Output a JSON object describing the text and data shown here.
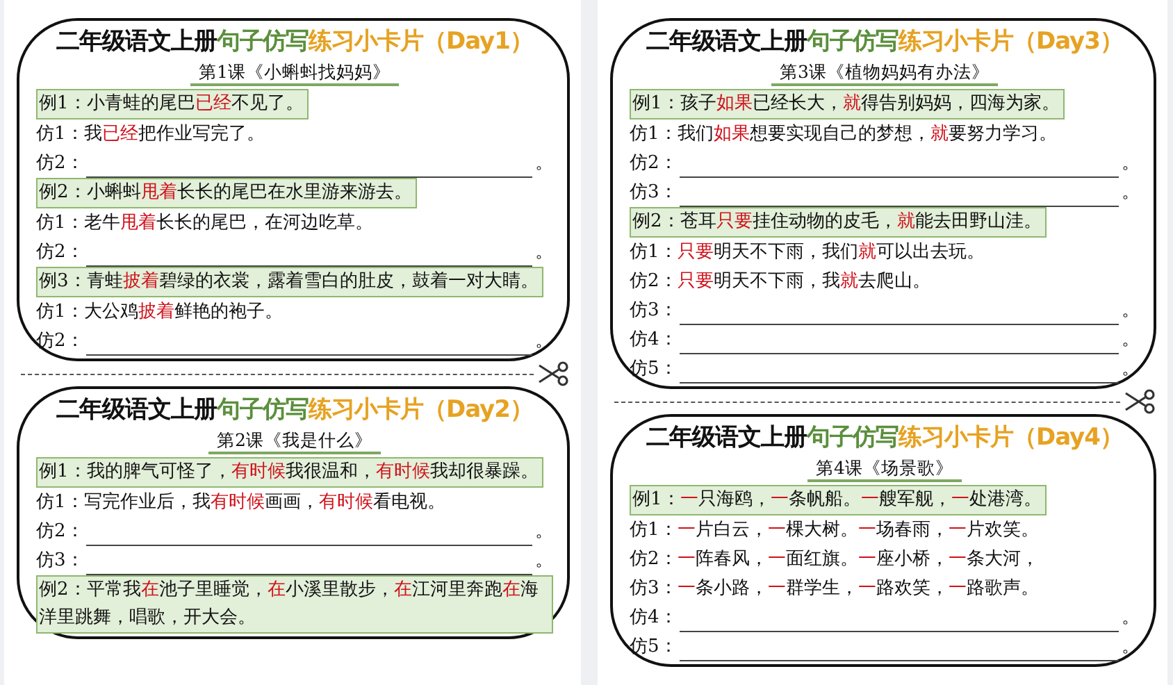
{
  "columns": [
    {
      "cards": [
        {
          "title_parts": [
            {
              "text": "二年级语文上册",
              "color": "#111111"
            },
            {
              "text": "句子仿写",
              "color": "#5b8f3c"
            },
            {
              "text": "练习小卡片（Day1）",
              "color": "#e6a222"
            }
          ],
          "lesson": "第1课《小蝌蚪找妈妈》",
          "rows": [
            {
              "kind": "example",
              "label": "例1：",
              "segments": [
                {
                  "text": "小青蛙的尾巴",
                  "highlight": false
                },
                {
                  "text": "已经",
                  "highlight": true
                },
                {
                  "text": "不见了。",
                  "highlight": false
                }
              ]
            },
            {
              "kind": "imitation",
              "label": "仿1：",
              "segments": [
                {
                  "text": "我",
                  "highlight": false
                },
                {
                  "text": "已经",
                  "highlight": true
                },
                {
                  "text": "把作业写完了。",
                  "highlight": false
                }
              ]
            },
            {
              "kind": "blank",
              "label": "仿2：",
              "end": "。"
            },
            {
              "kind": "example",
              "label": "例2：",
              "segments": [
                {
                  "text": "小蝌蚪",
                  "highlight": false
                },
                {
                  "text": "甩着",
                  "highlight": true
                },
                {
                  "text": "长长的尾巴在水里游来游去。",
                  "highlight": false
                }
              ]
            },
            {
              "kind": "imitation",
              "label": "仿1：",
              "segments": [
                {
                  "text": "老牛",
                  "highlight": false
                },
                {
                  "text": "甩着",
                  "highlight": true
                },
                {
                  "text": "长长的尾巴，在河边吃草。",
                  "highlight": false
                }
              ]
            },
            {
              "kind": "blank",
              "label": "仿2：",
              "end": "。"
            },
            {
              "kind": "example",
              "label": "例3：",
              "segments": [
                {
                  "text": "青蛙",
                  "highlight": false
                },
                {
                  "text": "披着",
                  "highlight": true
                },
                {
                  "text": "碧绿的衣裳，露着雪白的肚皮，鼓着一对大睛。",
                  "highlight": false
                }
              ]
            },
            {
              "kind": "imitation",
              "label": "仿1：",
              "segments": [
                {
                  "text": "大公鸡",
                  "highlight": false
                },
                {
                  "text": "披着",
                  "highlight": true
                },
                {
                  "text": "鲜艳的袍子。",
                  "highlight": false
                }
              ]
            },
            {
              "kind": "blank",
              "label": "仿2：",
              "end": "。"
            }
          ]
        },
        {
          "title_parts": [
            {
              "text": "二年级语文上册",
              "color": "#111111"
            },
            {
              "text": "句子仿写",
              "color": "#5b8f3c"
            },
            {
              "text": "练习小卡片（Day2）",
              "color": "#e6a222"
            }
          ],
          "lesson": "第2课《我是什么》",
          "rows": [
            {
              "kind": "example",
              "label": "例1：",
              "segments": [
                {
                  "text": "我的脾气可怪了，",
                  "highlight": false
                },
                {
                  "text": "有时候",
                  "highlight": true
                },
                {
                  "text": "我很温和，",
                  "highlight": false
                },
                {
                  "text": "有时候",
                  "highlight": true
                },
                {
                  "text": "我却很暴躁。",
                  "highlight": false
                }
              ]
            },
            {
              "kind": "imitation",
              "label": "仿1：",
              "segments": [
                {
                  "text": "写完作业后，我",
                  "highlight": false
                },
                {
                  "text": "有时候",
                  "highlight": true
                },
                {
                  "text": "画画，",
                  "highlight": false
                },
                {
                  "text": "有时候",
                  "highlight": true
                },
                {
                  "text": "看电视。",
                  "highlight": false
                }
              ]
            },
            {
              "kind": "blank",
              "label": "仿2：",
              "end": "。"
            },
            {
              "kind": "blank",
              "label": "仿3：",
              "end": "。"
            },
            {
              "kind": "example",
              "label": "例2：",
              "segments": [
                {
                  "text": "平常我",
                  "highlight": false
                },
                {
                  "text": "在",
                  "highlight": true
                },
                {
                  "text": "池子里睡觉，",
                  "highlight": false
                },
                {
                  "text": "在",
                  "highlight": true
                },
                {
                  "text": "小溪里散步，",
                  "highlight": false
                },
                {
                  "text": "在",
                  "highlight": true
                },
                {
                  "text": "江河里奔跑",
                  "highlight": false
                },
                {
                  "text": "在",
                  "highlight": true
                },
                {
                  "text": "海洋里跳舞，唱歌，开大会。",
                  "highlight": false
                }
              ]
            }
          ]
        }
      ]
    },
    {
      "cards": [
        {
          "title_parts": [
            {
              "text": "二年级语文上册",
              "color": "#111111"
            },
            {
              "text": "句子仿写",
              "color": "#5b8f3c"
            },
            {
              "text": "练习小卡片（Day3）",
              "color": "#e6a222"
            }
          ],
          "lesson": "第3课《植物妈妈有办法》",
          "rows": [
            {
              "kind": "example",
              "label": "例1：",
              "segments": [
                {
                  "text": "孩子",
                  "highlight": false
                },
                {
                  "text": "如果",
                  "highlight": true
                },
                {
                  "text": "已经长大，",
                  "highlight": false
                },
                {
                  "text": "就",
                  "highlight": true
                },
                {
                  "text": "得告别妈妈，四海为家。",
                  "highlight": false
                }
              ]
            },
            {
              "kind": "imitation",
              "label": "仿1：",
              "segments": [
                {
                  "text": "我们",
                  "highlight": false
                },
                {
                  "text": "如果",
                  "highlight": true
                },
                {
                  "text": "想要实现自己的梦想，",
                  "highlight": false
                },
                {
                  "text": "就",
                  "highlight": true
                },
                {
                  "text": "要努力学习。",
                  "highlight": false
                }
              ]
            },
            {
              "kind": "blank",
              "label": "仿2：",
              "end": "。"
            },
            {
              "kind": "blank",
              "label": "仿3：",
              "end": "。"
            },
            {
              "kind": "example",
              "label": "例2：",
              "segments": [
                {
                  "text": "苍耳",
                  "highlight": false
                },
                {
                  "text": "只要",
                  "highlight": true
                },
                {
                  "text": "挂住动物的皮毛，",
                  "highlight": false
                },
                {
                  "text": "就",
                  "highlight": true
                },
                {
                  "text": "能去田野山洼。",
                  "highlight": false
                }
              ]
            },
            {
              "kind": "imitation",
              "label": "仿1：",
              "segments": [
                {
                  "text": "只要",
                  "highlight": true
                },
                {
                  "text": "明天不下雨，我们",
                  "highlight": false
                },
                {
                  "text": "就",
                  "highlight": true
                },
                {
                  "text": "可以出去玩。",
                  "highlight": false
                }
              ]
            },
            {
              "kind": "imitation",
              "label": "仿2：",
              "segments": [
                {
                  "text": "只要",
                  "highlight": true
                },
                {
                  "text": "明天不下雨，我",
                  "highlight": false
                },
                {
                  "text": "就",
                  "highlight": true
                },
                {
                  "text": "去爬山。",
                  "highlight": false
                }
              ]
            },
            {
              "kind": "blank",
              "label": "仿3：",
              "end": "。"
            },
            {
              "kind": "blank",
              "label": "仿4：",
              "end": "。"
            },
            {
              "kind": "blank",
              "label": "仿5：",
              "end": "。"
            }
          ]
        },
        {
          "title_parts": [
            {
              "text": "二年级语文上册",
              "color": "#111111"
            },
            {
              "text": "句子仿写",
              "color": "#5b8f3c"
            },
            {
              "text": "练习小卡片（Day4）",
              "color": "#e6a222"
            }
          ],
          "lesson": "第4课《场景歌》",
          "rows": [
            {
              "kind": "example",
              "label": "例1：",
              "segments": [
                {
                  "text": "一",
                  "highlight": true
                },
                {
                  "text": "只海鸥，",
                  "highlight": false
                },
                {
                  "text": "一",
                  "highlight": true
                },
                {
                  "text": "条帆船。",
                  "highlight": false
                },
                {
                  "text": "一",
                  "highlight": true
                },
                {
                  "text": "艘军舰，",
                  "highlight": false
                },
                {
                  "text": "一",
                  "highlight": true
                },
                {
                  "text": "处港湾。",
                  "highlight": false
                }
              ]
            },
            {
              "kind": "imitation",
              "label": "仿1：",
              "segments": [
                {
                  "text": "一",
                  "highlight": true
                },
                {
                  "text": "片白云，",
                  "highlight": false
                },
                {
                  "text": "一",
                  "highlight": true
                },
                {
                  "text": "棵大树。",
                  "highlight": false
                },
                {
                  "text": "一",
                  "highlight": true
                },
                {
                  "text": "场春雨，",
                  "highlight": false
                },
                {
                  "text": "一",
                  "highlight": true
                },
                {
                  "text": "片欢笑。",
                  "highlight": false
                }
              ]
            },
            {
              "kind": "imitation",
              "label": "仿2：",
              "segments": [
                {
                  "text": "一",
                  "highlight": true
                },
                {
                  "text": "阵春风，",
                  "highlight": false
                },
                {
                  "text": "一",
                  "highlight": true
                },
                {
                  "text": "面红旗。",
                  "highlight": false
                },
                {
                  "text": "一",
                  "highlight": true
                },
                {
                  "text": "座小桥，",
                  "highlight": false
                },
                {
                  "text": "一",
                  "highlight": true
                },
                {
                  "text": "条大河，",
                  "highlight": false
                }
              ]
            },
            {
              "kind": "imitation",
              "label": "仿3：",
              "segments": [
                {
                  "text": "一",
                  "highlight": true
                },
                {
                  "text": "条小路，",
                  "highlight": false
                },
                {
                  "text": "一",
                  "highlight": true
                },
                {
                  "text": "群学生，",
                  "highlight": false
                },
                {
                  "text": "一",
                  "highlight": true
                },
                {
                  "text": "路欢笑，",
                  "highlight": false
                },
                {
                  "text": "一",
                  "highlight": true
                },
                {
                  "text": "路歌声。",
                  "highlight": false
                }
              ]
            },
            {
              "kind": "blank",
              "label": "仿4：",
              "end": "。"
            },
            {
              "kind": "blank",
              "label": "仿5：",
              "end": "。"
            }
          ]
        }
      ]
    }
  ]
}
